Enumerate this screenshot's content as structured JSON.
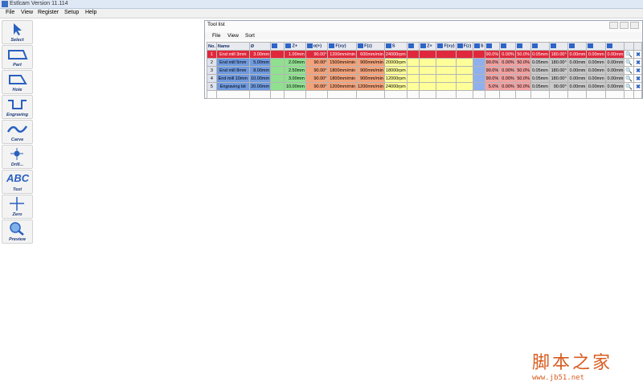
{
  "app": {
    "title": "Estlcam Version 11.114"
  },
  "menu": [
    "File",
    "View",
    "Register",
    "Setup",
    "Help"
  ],
  "toolbar": [
    {
      "label": "Select",
      "icon": "cursor-icon"
    },
    {
      "label": "Part",
      "icon": "part-outline-icon"
    },
    {
      "label": "Hole",
      "icon": "hole-outline-icon"
    },
    {
      "label": "Engraving",
      "icon": "engraving-icon"
    },
    {
      "label": "Carve",
      "icon": "carve-icon"
    },
    {
      "label": "Drill...",
      "icon": "drill-crosshair-icon"
    },
    {
      "label": "Text",
      "icon": "text-abc-icon",
      "glyph": "ABC"
    },
    {
      "label": "Zero",
      "icon": "zero-plus-icon"
    },
    {
      "label": "Preview",
      "icon": "magnifier-icon"
    }
  ],
  "tool_window": {
    "title": "Tool list",
    "menu": [
      "File",
      "View",
      "Sort"
    ],
    "header": [
      "No.",
      "Name",
      "Ø",
      "",
      "Z+",
      "α(+)",
      "F(xy)",
      "F(z)",
      "S",
      "",
      "Z+",
      "F(xy)",
      "F(z)",
      "S",
      "",
      "",
      "",
      "",
      "",
      "",
      "",
      "",
      "",
      "",
      "",
      ""
    ],
    "rows": [
      [
        "1",
        "End mill 3mm",
        "3.00mm",
        "1.00mm",
        "90.00°",
        "1200mm/min",
        "600mm/min",
        "24000rpm",
        "",
        "",
        "",
        "",
        "90.0%",
        "0.00%",
        "50.0%",
        "0.05mm",
        "180.00°",
        "0.00mm",
        "0.00mm",
        "0.00mm"
      ],
      [
        "2",
        "End mill 5mm",
        "5.00mm",
        "2.00mm",
        "90.00°",
        "1500mm/min",
        "900mm/min",
        "20000rpm",
        "",
        "",
        "",
        "",
        "90.0%",
        "0.00%",
        "50.0%",
        "0.05mm",
        "180.00°",
        "0.00mm",
        "0.00mm",
        "0.00mm"
      ],
      [
        "3",
        "End mill 8mm",
        "8.00mm",
        "2.50mm",
        "90.00°",
        "1800mm/min",
        "900mm/min",
        "18000rpm",
        "",
        "",
        "",
        "",
        "90.0%",
        "0.00%",
        "50.0%",
        "0.05mm",
        "180.00°",
        "0.00mm",
        "0.00mm",
        "0.00mm"
      ],
      [
        "4",
        "End mill 10mm",
        "10.00mm",
        "3.00mm",
        "90.00°",
        "1800mm/min",
        "900mm/min",
        "12000rpm",
        "",
        "",
        "",
        "",
        "90.0%",
        "0.00%",
        "50.0%",
        "0.05mm",
        "180.00°",
        "0.00mm",
        "0.00mm",
        "0.00mm"
      ],
      [
        "5",
        "Engraving bit",
        "20.00mm",
        "10.00mm",
        "90.00°",
        "1200mm/min",
        "1200mm/min",
        "24000rpm",
        "",
        "",
        "",
        "",
        "5.0%",
        "0.00%",
        "50.0%",
        "0.05mm",
        "90.00°",
        "0.00mm",
        "0.00mm",
        "0.00mm"
      ]
    ]
  },
  "watermark": {
    "line1": "脚本之家",
    "line2": "www.jb51.net"
  }
}
